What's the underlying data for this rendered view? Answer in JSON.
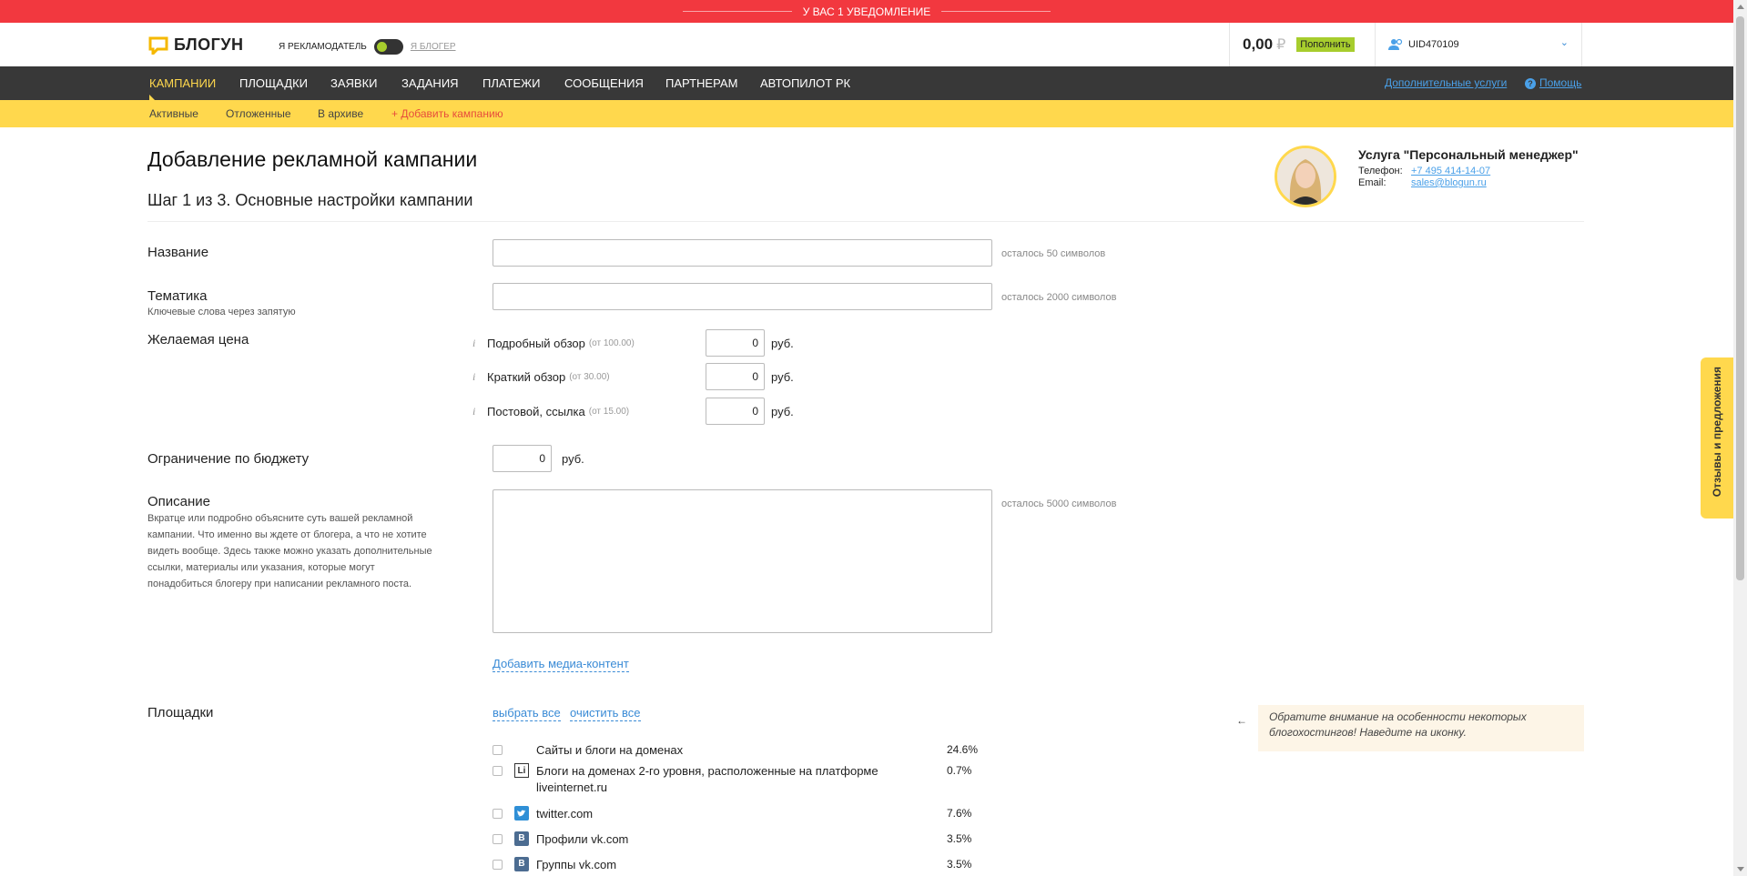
{
  "notification": "У ВАС 1 УВЕДОМЛЕНИЕ",
  "logo": "БЛОГУН",
  "role": {
    "advertiser": "Я РЕКЛАМОДАТЕЛЬ",
    "blogger": "Я БЛОГЕР"
  },
  "balance": {
    "amount": "0,00",
    "currency": "₽",
    "topup": "Пополнить"
  },
  "user": {
    "uid": "UID470109"
  },
  "nav": {
    "items": [
      "КАМПАНИИ",
      "ПЛОЩАДКИ",
      "ЗАЯВКИ",
      "ЗАДАНИЯ",
      "ПЛАТЕЖИ",
      "СООБЩЕНИЯ",
      "ПАРТНЕРАМ",
      "АВТОПИЛОТ РК"
    ],
    "extra": "Дополнительные услуги",
    "help": "Помощь"
  },
  "subnav": {
    "active": "Активные",
    "deferred": "Отложенные",
    "archive": "В архиве",
    "add": "+ Добавить кампанию"
  },
  "page": {
    "title": "Добавление рекламной кампании",
    "step": "Шаг 1 из 3. Основные настройки кампании"
  },
  "manager": {
    "title": "Услуга \"Персональный менеджер\"",
    "phone_label": "Телефон:",
    "phone": "+7 495 414-14-07",
    "email_label": "Email:",
    "email": "sales@blogun.ru"
  },
  "form": {
    "name_label": "Название",
    "name_note": "осталось 50 символов",
    "topic_label": "Тематика",
    "topic_hint": "Ключевые слова через запятую",
    "topic_note": "осталось 2000 символов",
    "price_label": "Желаемая цена",
    "prices": [
      {
        "name": "Подробный обзор",
        "min": "(от 100.00)",
        "value": "0",
        "unit": "руб."
      },
      {
        "name": "Краткий обзор",
        "min": "(от 30.00)",
        "value": "0",
        "unit": "руб."
      },
      {
        "name": "Постовой, ссылка",
        "min": "(от 15.00)",
        "value": "0",
        "unit": "руб."
      }
    ],
    "budget_label": "Ограничение по бюджету",
    "budget_value": "0",
    "budget_unit": "руб.",
    "desc_label": "Описание",
    "desc_hint": "Вкратце или подробно объясните суть вашей рекламной кампании. Что именно вы ждете от блогера, а что не хотите видеть вообще. Здесь также можно указать дополнительные ссылки, материалы или указания, которые могут понадобиться блогеру при написании рекламного поста.",
    "desc_note": "осталось 5000 символов",
    "media_link": "Добавить медиа-контент",
    "platforms_label": "Площадки",
    "select_all": "выбрать все",
    "clear_all": "очистить все",
    "tip": "Обратите внимание на особенности некоторых блогохостингов! Наведите на иконку.",
    "platforms": [
      {
        "name": "Сайты и блоги на доменах",
        "pct": "24.6%",
        "icon": "none"
      },
      {
        "name": "Блоги на доменах 2-го уровня, расположенные на платформе liveinternet.ru",
        "pct": "0.7%",
        "icon": "li-icon",
        "icon_text": "Li"
      },
      {
        "name": "twitter.com",
        "pct": "7.6%",
        "icon": "twitter-icon"
      },
      {
        "name": "Профили vk.com",
        "pct": "3.5%",
        "icon": "vk-icon",
        "icon_text": "В"
      },
      {
        "name": "Группы vk.com",
        "pct": "3.5%",
        "icon": "vk-icon",
        "icon_text": "В"
      }
    ]
  },
  "feedback": "Отзывы и предложения",
  "colors": {
    "red": "#f2383f",
    "yellow": "#ffd84d",
    "dark": "#383838",
    "green": "#a7cd2d",
    "link": "#4aa0e8"
  }
}
